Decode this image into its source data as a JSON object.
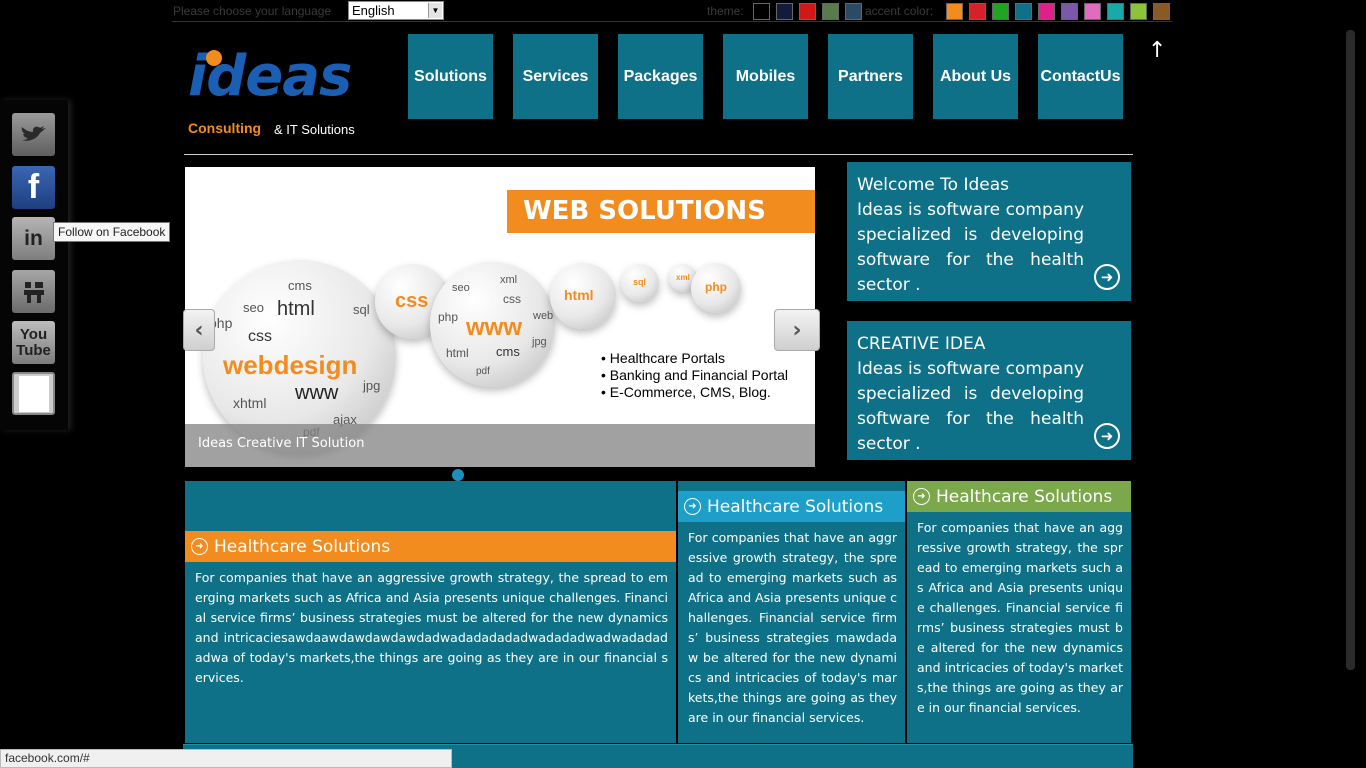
{
  "topbar": {
    "language_label": "Please choose your language",
    "language_selected": "English",
    "theme_label": "theme:",
    "accent_label": "accent color:",
    "theme_colors": [
      "#000000",
      "#141a3c",
      "#d11818",
      "#577b4a",
      "#2b4b63"
    ],
    "accent_colors": [
      "#f28c1f",
      "#d6202a",
      "#22a322",
      "#0f7187",
      "#e0208a",
      "#7a5aa8",
      "#e06cbf",
      "#1aa8a8",
      "#8bc43a",
      "#8a5a24"
    ]
  },
  "logo": {
    "word": "ideas",
    "line1": "Consulting",
    "line2": "& IT Solutions"
  },
  "nav": {
    "items": [
      "Solutions",
      "Services",
      "Packages",
      "Mobiles",
      "Partners",
      "About Us",
      "ContactUs"
    ]
  },
  "social": {
    "tooltip": "Follow on Facebook",
    "items": [
      "twitter",
      "facebook",
      "linkedin",
      "digg",
      "youtube",
      "blank"
    ]
  },
  "slider": {
    "banner_title": "WEB SOLUTIONS",
    "bullets": [
      "• Healthcare Portals",
      "• Banking and Financial Portal",
      "• E-Commerce, CMS, Blog."
    ],
    "caption": "Ideas Creative IT Solution",
    "ball_words": {
      "big_main": "webdesign",
      "big_words": [
        "seo",
        "cms",
        "html",
        "sql",
        "css",
        "php",
        "www",
        "jpg",
        "xhtml",
        "ajax",
        "pdf"
      ],
      "mid_main": "www",
      "mid_words": [
        "seo",
        "xml",
        "php",
        "css",
        "cms",
        "web",
        "html",
        "jpg",
        "pdf"
      ],
      "small1_main": "css",
      "small2_main": "html",
      "small3_main": "sql",
      "small4_main": "xml",
      "small5_main": "php"
    },
    "prev_label": "‹",
    "next_label": "›",
    "dots_count": 5
  },
  "info_boxes": [
    {
      "title": "Welcome To Ideas",
      "text": "Ideas is software company specialized is developing software for the health sector ."
    },
    {
      "title": "CREATIVE IDEA",
      "text": "Ideas is software company specialized is developing software for the health sector ."
    }
  ],
  "columns": [
    {
      "title": "Healthcare Solutions",
      "color": "#f28c1f",
      "text": "For companies that have an aggressive growth strategy, the spread to emerging markets such as Africa and Asia presents unique challenges. Financial service firms’ business strategies must be altered for the new dynamics and intricaciesawdaawdawdawdawdadwadadadadadwadadadwadwadadadadwa of today's markets,the things are going as they are in our financial services."
    },
    {
      "title": "Healthcare Solutions",
      "color": "#1d9fc9",
      "text": "For companies that have an aggressive growth strategy, the spread to emerging markets such as Africa and Asia presents unique challenges. Financial service firms’ business strategies mawdadaw be altered for the new dynamics and intricacies of today's markets,the things are going as they are in our financial services."
    },
    {
      "title": "Healthcare Solutions",
      "color": "#7aa84a",
      "text": "For companies that have an aggressive growth strategy, the spread to emerging markets such as Africa and Asia presents unique challenges. Financial service firms’ business strategies must be altered for the new dynamics and intricacies of today's markets,the things are going as they are in our financial services."
    }
  ],
  "status_bar": "facebook.com/#"
}
